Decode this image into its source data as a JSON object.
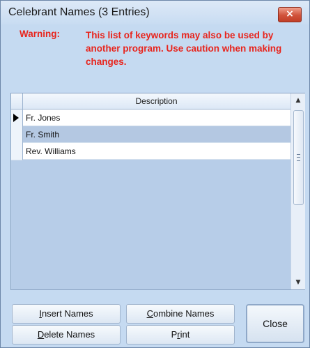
{
  "window": {
    "title": "Celebrant Names (3 Entries)",
    "close_glyph": "×"
  },
  "warning": {
    "label": "Warning:",
    "text": "This list of keywords may also be used by another program. Use caution when making changes.",
    "color": "#e8241c"
  },
  "grid": {
    "column_header": "Description",
    "rows": [
      {
        "text": "Fr. Jones",
        "current": true
      },
      {
        "text": "Fr. Smith",
        "selected": true
      },
      {
        "text": "Rev. Williams"
      }
    ],
    "scroll_up_glyph": "▲",
    "scroll_down_glyph": "▼"
  },
  "buttons": {
    "insert": {
      "mnemonic": "I",
      "rest": "nsert Names"
    },
    "combine": {
      "mnemonic": "C",
      "rest": "ombine Names"
    },
    "delete": {
      "mnemonic": "D",
      "rest": "elete Names"
    },
    "print": {
      "pre": "P",
      "mnemonic": "r",
      "rest": "int"
    },
    "close": "Close"
  },
  "colors": {
    "window_bg": "#c5daf1",
    "selection": "#b4c8e2",
    "close_button": "#d0523a"
  }
}
